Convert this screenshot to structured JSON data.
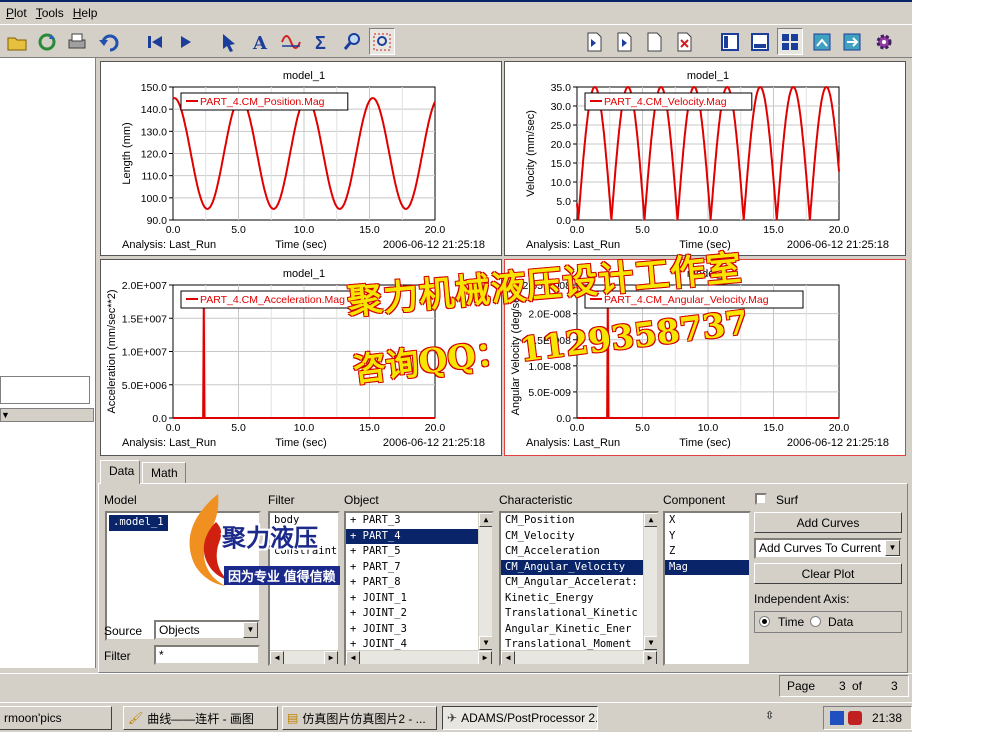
{
  "menu": [
    {
      "label": "Plot",
      "underline": "P"
    },
    {
      "label": "Tools",
      "underline": "T"
    },
    {
      "label": "Help",
      "underline": "H"
    }
  ],
  "toolbar_icons": [
    "open-folder-icon",
    "reload-icon",
    "print-icon",
    "undo-icon",
    "first-page-icon",
    "next-page-icon",
    "select-arrow-icon",
    "text-icon",
    "curve-edit-icon",
    "sigma-icon",
    "zoom-icon",
    "fit-icon",
    "import-page-icon",
    "export-page-icon",
    "new-page-icon",
    "delete-page-icon",
    "layout-1-icon",
    "layout-2-icon",
    "layout-4-icon",
    "table-icon",
    "toggle-icon",
    "settings-gear-icon"
  ],
  "plots": [
    {
      "name": "position",
      "title": "model_1",
      "legend": "PART_4.CM_Position.Mag",
      "ylabel": "Length (mm)",
      "xlabel": "Time (sec)",
      "analysis": "Analysis:  Last_Run",
      "timestamp": "2006-06-12 21:25:18",
      "yticks": [
        "150.0",
        "140.0",
        "130.0",
        "120.0",
        "110.0",
        "100.0",
        "90.0"
      ],
      "xticks": [
        "0.0",
        "5.0",
        "10.0",
        "15.0",
        "20.0"
      ]
    },
    {
      "name": "velocity",
      "title": "model_1",
      "legend": "PART_4.CM_Velocity.Mag",
      "ylabel": "Velocity (mm/sec)",
      "xlabel": "Time (sec)",
      "analysis": "Analysis:  Last_Run",
      "timestamp": "2006-06-12 21:25:18",
      "yticks": [
        "35.0",
        "30.0",
        "25.0",
        "20.0",
        "15.0",
        "10.0",
        "5.0",
        "0.0"
      ],
      "xticks": [
        "0.0",
        "5.0",
        "10.0",
        "15.0",
        "20.0"
      ]
    },
    {
      "name": "acceleration",
      "title": "model_1",
      "legend": "PART_4.CM_Acceleration.Mag",
      "ylabel": "Acceleration (mm/sec**2)",
      "xlabel": "Time (sec)",
      "analysis": "Analysis:  Last_Run",
      "timestamp": "2006-06-12 21:25:18",
      "yticks": [
        "2.0E+007",
        "1.5E+007",
        "1.0E+007",
        "5.0E+006",
        "0.0"
      ],
      "xticks": [
        "0.0",
        "5.0",
        "10.0",
        "15.0",
        "20.0"
      ]
    },
    {
      "name": "angular-velocity",
      "title": "model_1",
      "legend": "PART_4.CM_Angular_Velocity.Mag",
      "ylabel": "Angular Velocity (deg/sec)",
      "xlabel": "Time (sec)",
      "analysis": "Analysis:  Last_Run",
      "timestamp": "2006-06-12 21:25:18",
      "yticks": [
        "2.55E-008",
        "2.0E-008",
        "1.5E-008",
        "1.0E-008",
        "5.0E-009",
        "0.0"
      ],
      "xticks": [
        "0.0",
        "5.0",
        "10.0",
        "15.0",
        "20.0"
      ]
    }
  ],
  "chart_data": [
    {
      "type": "line",
      "title": "model_1",
      "xlabel": "Time (sec)",
      "ylabel": "Length (mm)",
      "xlim": [
        0,
        20
      ],
      "ylim": [
        90,
        150
      ],
      "series": [
        {
          "name": "PART_4.CM_Position.Mag",
          "color": "#e00000",
          "curve": "cosine",
          "min": 95,
          "max": 145,
          "period": 5.05,
          "x_start": 0,
          "x_end": 20
        }
      ]
    },
    {
      "type": "line",
      "title": "model_1",
      "xlabel": "Time (sec)",
      "ylabel": "Velocity (mm/sec)",
      "xlim": [
        0,
        20
      ],
      "ylim": [
        0,
        35
      ],
      "series": [
        {
          "name": "PART_4.CM_Velocity.Mag",
          "color": "#e00000",
          "curve": "abs-sine",
          "min": 0,
          "max": 35,
          "period": 5.05,
          "x_start": 0,
          "x_end": 20
        }
      ]
    },
    {
      "type": "line",
      "title": "model_1",
      "xlabel": "Time (sec)",
      "ylabel": "Acceleration (mm/sec**2)",
      "xlim": [
        0,
        20
      ],
      "ylim": [
        0,
        20000000
      ],
      "series": [
        {
          "name": "PART_4.CM_Acceleration.Mag",
          "color": "#e00000",
          "curve": "spike",
          "baseline": 0,
          "spike_x": 2.35,
          "spike_y": 17500000,
          "x_start": 0,
          "x_end": 20
        }
      ]
    },
    {
      "type": "line",
      "title": "model_1",
      "xlabel": "Time (sec)",
      "ylabel": "Angular Velocity (deg/sec)",
      "xlim": [
        0,
        20
      ],
      "ylim": [
        0,
        2.55e-08
      ],
      "series": [
        {
          "name": "PART_4.CM_Angular_Velocity.Mag",
          "color": "#e00000",
          "curve": "spike",
          "baseline": 0,
          "spike_x": 2.35,
          "spike_y": 2.3e-08,
          "x_start": 0,
          "x_end": 20
        }
      ]
    }
  ],
  "tabs": [
    "Data",
    "Math"
  ],
  "data_panel": {
    "model_label": "Model",
    "models": [
      ".model_1"
    ],
    "filter_label": "Filter",
    "filters": [
      "body",
      "force",
      "constraint"
    ],
    "object_label": "Object",
    "objects": [
      "+ PART_3",
      "+ PART_4",
      "+ PART_5",
      "+ PART_7",
      "+ PART_8",
      "+ JOINT_1",
      "+ JOINT_2",
      "+ JOINT_3",
      "+ JOINT_4"
    ],
    "characteristic_label": "Characteristic",
    "characteristics": [
      "CM_Position",
      "CM_Velocity",
      "CM_Acceleration",
      "CM_Angular_Velocity",
      "CM_Angular_Accelerat:",
      "Kinetic_Energy",
      "Translational_Kinetic",
      "Angular_Kinetic_Ener",
      "Translational_Moment"
    ],
    "component_label": "Component",
    "components": [
      "X",
      "Y",
      "Z",
      "Mag"
    ],
    "surf_label": "Surf",
    "add_curves": "Add Curves",
    "add_mode": "Add Curves To Current Plo",
    "clear_plot": "Clear Plot",
    "independent_axis_label": "Independent Axis:",
    "axis_time": "Time",
    "axis_data": "Data",
    "source_label": "Source",
    "source_value": "Objects",
    "filter_field_label": "Filter",
    "filter_field_value": "*"
  },
  "status": {
    "page_label": "Page",
    "page_current": "3",
    "page_of": "of",
    "page_total": "3"
  },
  "taskbar": {
    "tasks": [
      "rmoon'pics",
      "曲线——连杆 - 画图",
      "仿真图片仿真图片2 - ...",
      "ADAMS/PostProcessor 2..."
    ],
    "clock": "21:38"
  },
  "watermark": {
    "line1": "聚力机械液压设计工作室",
    "line2": "咨询QQ：  1129358737",
    "logo_text": "聚力液压",
    "logo_slogan": "因为专业 值得信赖"
  }
}
